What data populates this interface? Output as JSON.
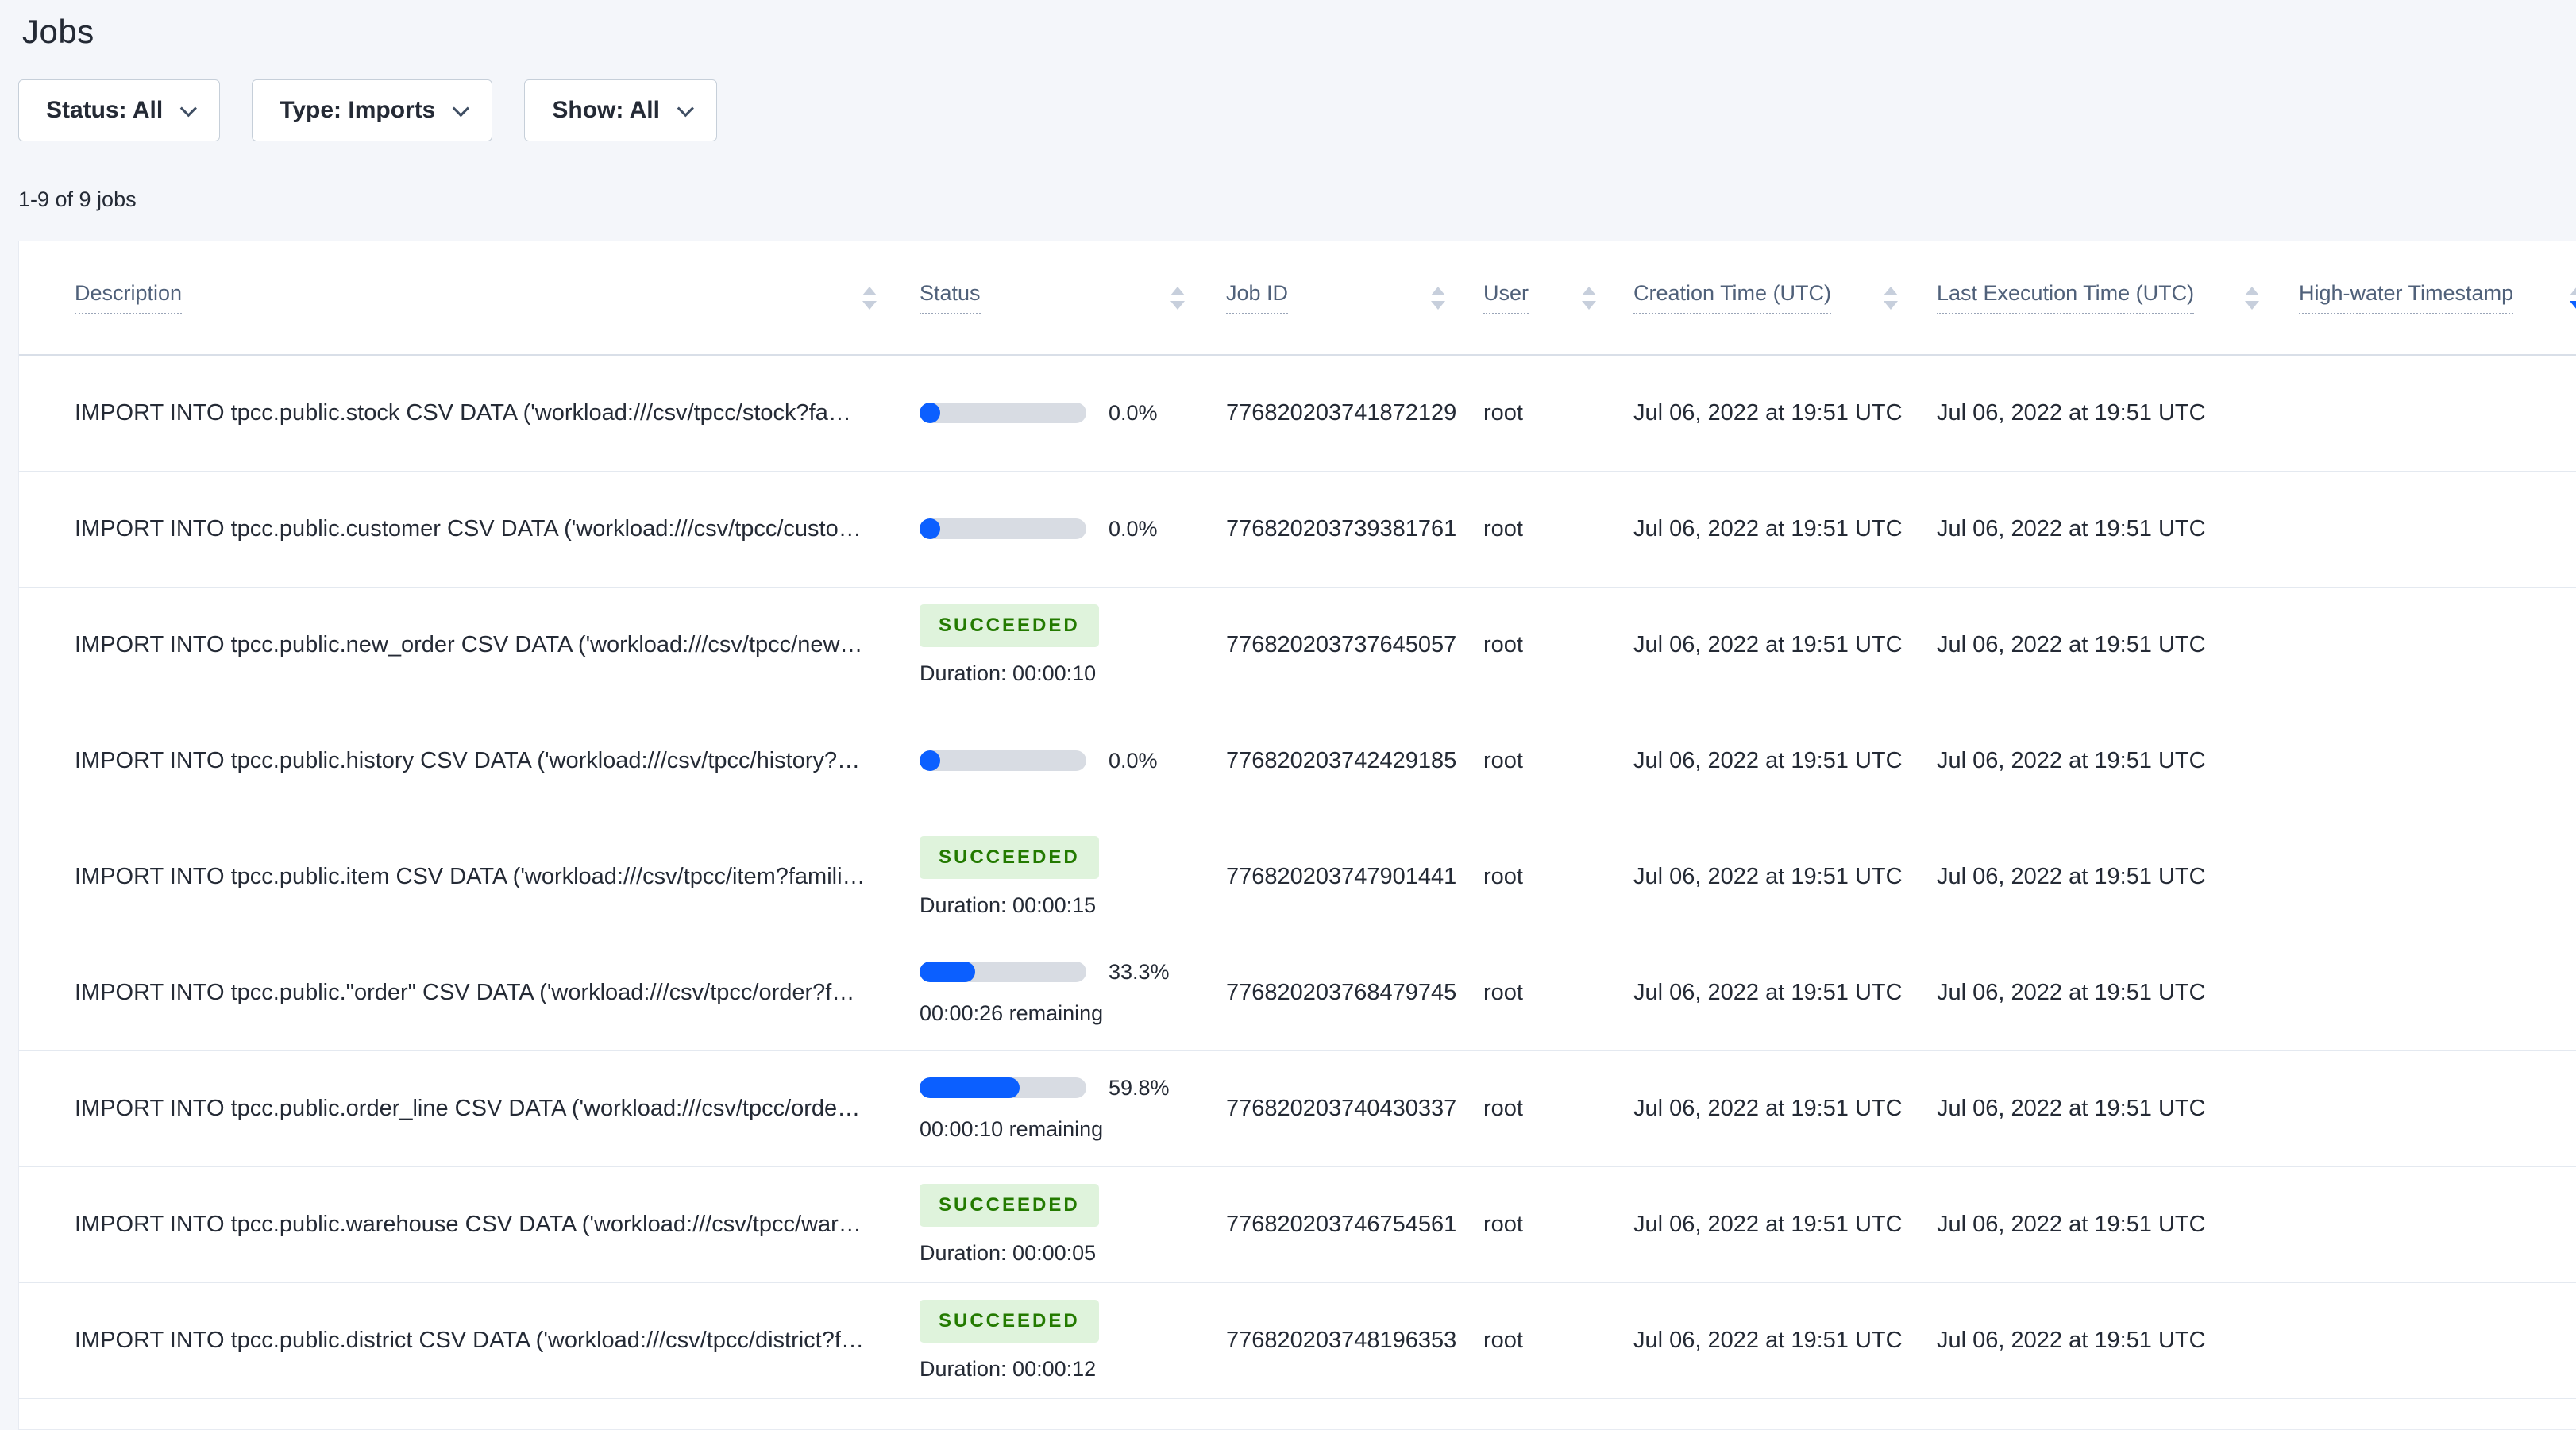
{
  "page": {
    "title": "Jobs",
    "jobs_count_label": "1-9 of 9 jobs"
  },
  "filters": [
    {
      "label": "Status: All"
    },
    {
      "label": "Type: Imports"
    },
    {
      "label": "Show: All"
    }
  ],
  "table": {
    "columns": [
      {
        "label": "Description",
        "sortable": true
      },
      {
        "label": "Status",
        "sortable": true
      },
      {
        "label": "Job ID",
        "sortable": true
      },
      {
        "label": "User",
        "sortable": true
      },
      {
        "label": "Creation Time (UTC)",
        "sortable": true
      },
      {
        "label": "Last Execution Time (UTC)",
        "sortable": true
      },
      {
        "label": "High-water Timestamp",
        "sortable": true
      }
    ],
    "sort_direction": "desc",
    "rows": [
      {
        "description": "IMPORT INTO tpcc.public.stock CSV DATA ('workload:///csv/tpcc/stock?families…",
        "status": {
          "type": "progress",
          "percent": "0.0%",
          "fraction": 0
        },
        "job_id": "776820203741872129",
        "user": "root",
        "creation_time": "Jul 06, 2022 at 19:51 UTC",
        "last_execution_time": "Jul 06, 2022 at 19:51 UTC",
        "high_water_timestamp": ""
      },
      {
        "description": "IMPORT INTO tpcc.public.customer CSV DATA ('workload:///csv/tpcc/customer?f…",
        "status": {
          "type": "progress",
          "percent": "0.0%",
          "fraction": 0
        },
        "job_id": "776820203739381761",
        "user": "root",
        "creation_time": "Jul 06, 2022 at 19:51 UTC",
        "last_execution_time": "Jul 06, 2022 at 19:51 UTC",
        "high_water_timestamp": ""
      },
      {
        "description": "IMPORT INTO tpcc.public.new_order CSV DATA ('workload:///csv/tpcc/new_ord…",
        "status": {
          "type": "succeeded",
          "label": "SUCCEEDED",
          "duration": "Duration: 00:00:10"
        },
        "job_id": "776820203737645057",
        "user": "root",
        "creation_time": "Jul 06, 2022 at 19:51 UTC",
        "last_execution_time": "Jul 06, 2022 at 19:51 UTC",
        "high_water_timestamp": ""
      },
      {
        "description": "IMPORT INTO tpcc.public.history CSV DATA ('workload:///csv/tpcc/history?famil…",
        "status": {
          "type": "progress",
          "percent": "0.0%",
          "fraction": 0
        },
        "job_id": "776820203742429185",
        "user": "root",
        "creation_time": "Jul 06, 2022 at 19:51 UTC",
        "last_execution_time": "Jul 06, 2022 at 19:51 UTC",
        "high_water_timestamp": ""
      },
      {
        "description": "IMPORT INTO tpcc.public.item CSV DATA ('workload:///csv/tpcc/item?families=f…",
        "status": {
          "type": "succeeded",
          "label": "SUCCEEDED",
          "duration": "Duration: 00:00:15"
        },
        "job_id": "776820203747901441",
        "user": "root",
        "creation_time": "Jul 06, 2022 at 19:51 UTC",
        "last_execution_time": "Jul 06, 2022 at 19:51 UTC",
        "high_water_timestamp": ""
      },
      {
        "description": "IMPORT INTO tpcc.public.\"order\" CSV DATA ('workload:///csv/tpcc/order?familie…",
        "status": {
          "type": "progress",
          "percent": "33.3%",
          "fraction": 0.333,
          "remaining": "00:00:26 remaining"
        },
        "job_id": "776820203768479745",
        "user": "root",
        "creation_time": "Jul 06, 2022 at 19:51 UTC",
        "last_execution_time": "Jul 06, 2022 at 19:51 UTC",
        "high_water_timestamp": ""
      },
      {
        "description": "IMPORT INTO tpcc.public.order_line CSV DATA ('workload:///csv/tpcc/order_lin…",
        "status": {
          "type": "progress",
          "percent": "59.8%",
          "fraction": 0.598,
          "remaining": "00:00:10 remaining"
        },
        "job_id": "776820203740430337",
        "user": "root",
        "creation_time": "Jul 06, 2022 at 19:51 UTC",
        "last_execution_time": "Jul 06, 2022 at 19:51 UTC",
        "high_water_timestamp": ""
      },
      {
        "description": "IMPORT INTO tpcc.public.warehouse CSV DATA ('workload:///csv/tpcc/warehou…",
        "status": {
          "type": "succeeded",
          "label": "SUCCEEDED",
          "duration": "Duration: 00:00:05"
        },
        "job_id": "776820203746754561",
        "user": "root",
        "creation_time": "Jul 06, 2022 at 19:51 UTC",
        "last_execution_time": "Jul 06, 2022 at 19:51 UTC",
        "high_water_timestamp": ""
      },
      {
        "description": "IMPORT INTO tpcc.public.district CSV DATA ('workload:///csv/tpcc/district?famil…",
        "status": {
          "type": "succeeded",
          "label": "SUCCEEDED",
          "duration": "Duration: 00:00:12"
        },
        "job_id": "776820203748196353",
        "user": "root",
        "creation_time": "Jul 06, 2022 at 19:51 UTC",
        "last_execution_time": "Jul 06, 2022 at 19:51 UTC",
        "high_water_timestamp": ""
      }
    ]
  },
  "colors": {
    "accent_blue": "#0b5fff",
    "progress_track": "#d8dce3",
    "success_bg": "#dff3dc",
    "success_text": "#237a00",
    "page_bg": "#f4f6fa"
  }
}
